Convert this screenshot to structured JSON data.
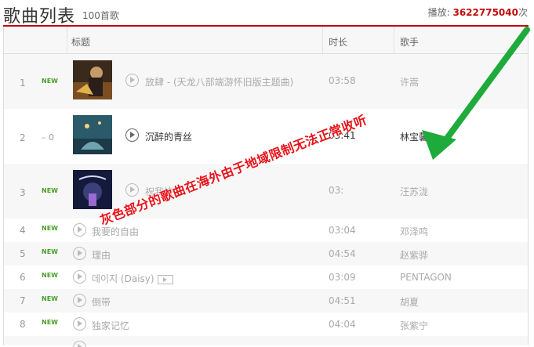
{
  "header": {
    "title": "歌曲列表",
    "count": "100首歌",
    "plays_label": "播放:",
    "plays_value": "3622775040",
    "plays_unit": "次"
  },
  "columns": {
    "title": "标题",
    "duration": "时长",
    "artist": "歌手"
  },
  "rows": [
    {
      "index": "1",
      "badge": "NEW",
      "title": "放肆 - (天龙八部端游怀旧版主题曲)",
      "duration": "03:58",
      "artist": "许嵩",
      "cover": "cover-1"
    },
    {
      "index": "2",
      "badge": "– 0",
      "title": "沉醉的青丝",
      "duration": "03:41",
      "artist": "林宝馨",
      "cover": "cover-2"
    },
    {
      "index": "3",
      "badge": "NEW",
      "title": "祝我快乐",
      "duration": "03:",
      "artist": "汪苏泷",
      "cover": "cover-3"
    },
    {
      "index": "4",
      "badge": "NEW",
      "title": "我要的自由",
      "duration": "03:04",
      "artist": "邓泽鸣"
    },
    {
      "index": "5",
      "badge": "NEW",
      "title": "理由",
      "duration": "04:54",
      "artist": "赵紫骅"
    },
    {
      "index": "6",
      "badge": "NEW",
      "title": "데이지 (Daisy)",
      "duration": "03:09",
      "artist": "PENTAGON"
    },
    {
      "index": "7",
      "badge": "NEW",
      "title": "倒带",
      "duration": "04:51",
      "artist": "胡夏"
    },
    {
      "index": "8",
      "badge": "NEW",
      "title": "独家记忆",
      "duration": "04:04",
      "artist": "张紫宁"
    }
  ],
  "annotation": {
    "text": "灰色部分的歌曲在海外由于地域限制无法正常收听",
    "text_color": "#e8131a",
    "arrow_color": "#1faa3c"
  },
  "colors": {
    "accent": "#c20c0c",
    "new_badge": "#4a9e2a"
  }
}
